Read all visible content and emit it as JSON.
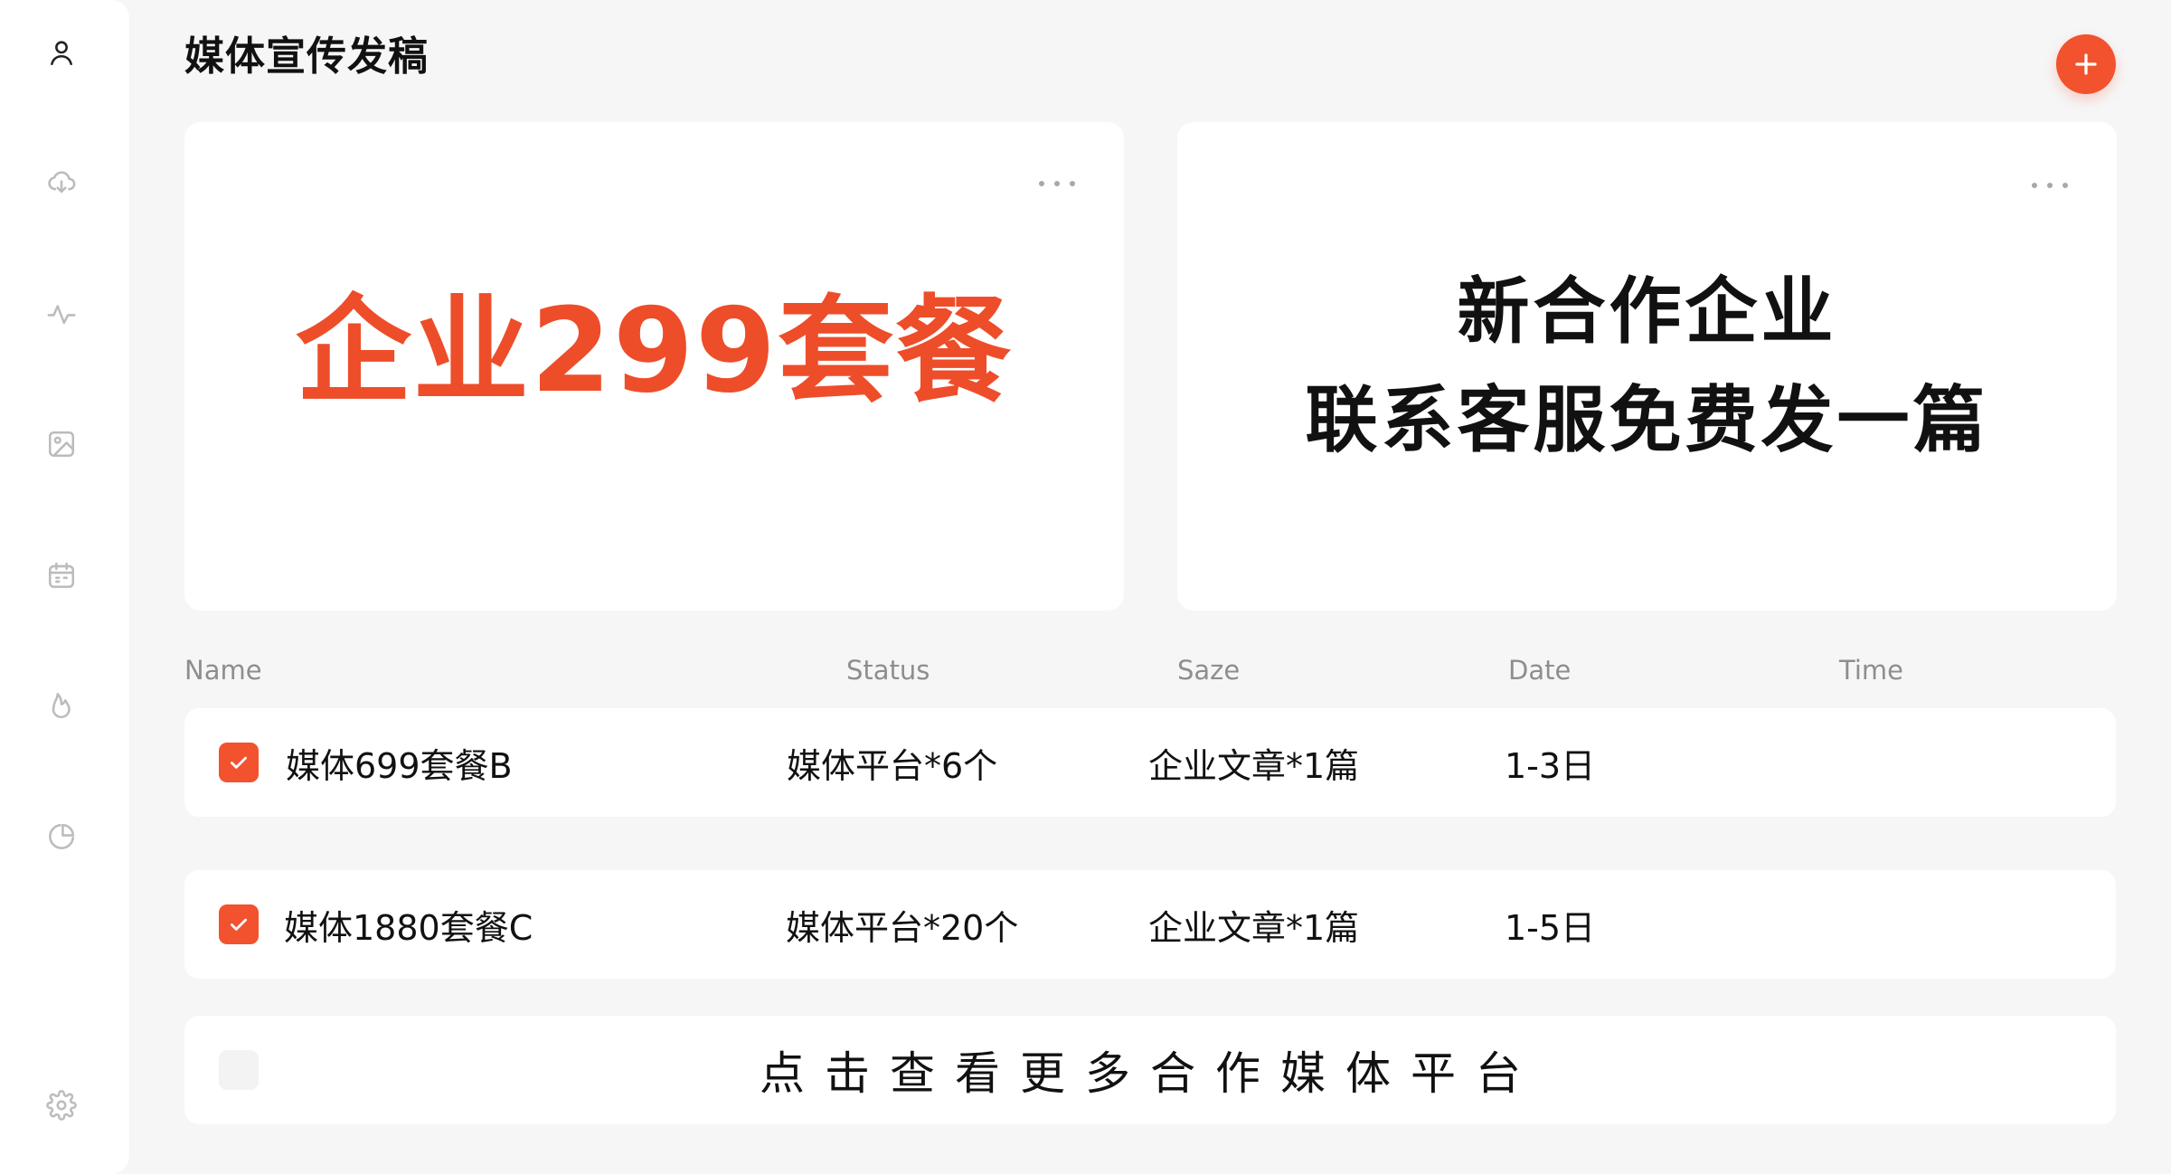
{
  "header": {
    "title": "媒体宣传发稿",
    "add_icon": "plus-icon"
  },
  "sidebar": {
    "icons": [
      "user-icon",
      "cloud-download-icon",
      "activity-icon",
      "image-icon",
      "calendar-icon",
      "fire-icon",
      "pie-chart-icon",
      "settings-icon"
    ]
  },
  "cards": {
    "left": {
      "headline": "企业299套餐"
    },
    "right": {
      "line1": "新合作企业",
      "line2": "联系客服免费发一篇"
    }
  },
  "table": {
    "columns": [
      "Name",
      "Status",
      "Saze",
      "Date",
      "Time"
    ],
    "rows": [
      {
        "name": "媒体699套餐B",
        "status": "媒体平台*6个",
        "size": "企业文章*1篇",
        "date": "1-3日",
        "time": ""
      },
      {
        "name": "媒体1880套餐C",
        "status": "媒体平台*20个",
        "size": "企业文章*1篇",
        "date": "1-5日",
        "time": ""
      }
    ],
    "more_label": "点击查看更多合作媒体平台"
  },
  "colors": {
    "accent": "#f2522e",
    "background": "#f6f6f7",
    "card": "#ffffff",
    "muted_text": "#8e8e8e"
  }
}
